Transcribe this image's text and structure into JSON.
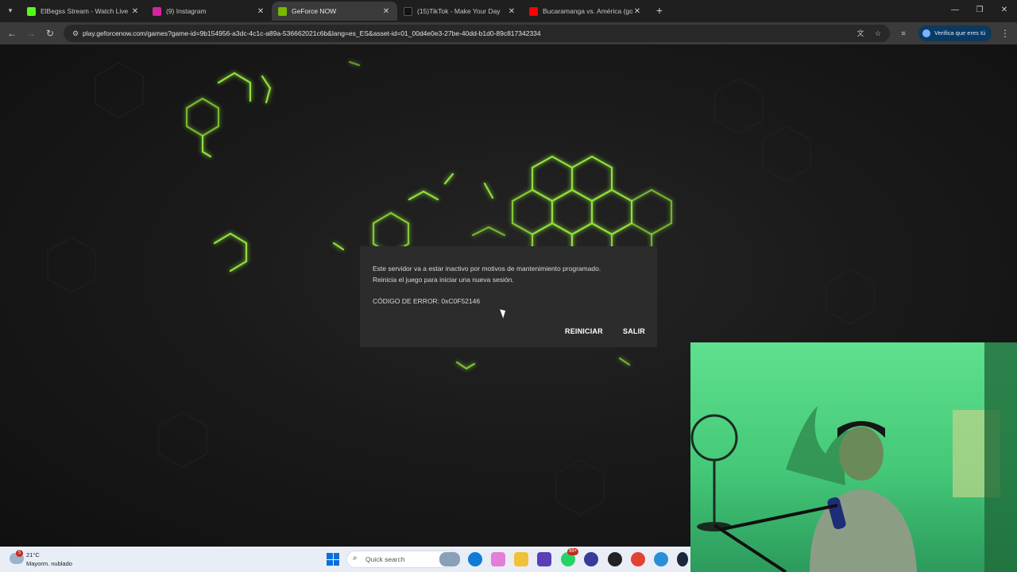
{
  "tabs": [
    {
      "title": "ElBegss Stream - Watch Live on",
      "favicon_color": "#53fc18",
      "favicon_icon": "kick-icon",
      "active": false
    },
    {
      "title": "(9) Instagram",
      "favicon_color": "#d6249f",
      "favicon_icon": "instagram-icon",
      "active": false
    },
    {
      "title": "GeForce NOW",
      "favicon_color": "#76b900",
      "favicon_icon": "nvidia-icon",
      "active": true
    },
    {
      "title": "(15)TikTok - Make Your Day",
      "favicon_color": "#111111",
      "favicon_icon": "tiktok-icon",
      "active": false
    },
    {
      "title": "Bucaramanga vs. América (gol",
      "favicon_color": "#ff0000",
      "favicon_icon": "youtube-icon",
      "active": false
    }
  ],
  "address_bar": {
    "url": "play.geforcenow.com/games?game-id=9b154956-a3dc-4c1c-a89a-536662021c6b&lang=es_ES&asset-id=01_00d4e0e3-27be-40dd-b1d0-89c817342334"
  },
  "profile_chip": {
    "label": "Verifica que eres tú"
  },
  "dialog": {
    "message_line1": "Este servidor va a estar inactivo por motivos de mantenimiento programado.",
    "message_line2": "Reinicia el juego para iniciar una nueva sesión.",
    "error_code": "CÓDIGO DE ERROR: 0xC0F52146",
    "restart_label": "REINICIAR",
    "exit_label": "SALIR"
  },
  "taskbar": {
    "weather_temp": "21°C",
    "weather_condition": "Mayorm. nublado",
    "weather_badge": "5",
    "search_placeholder": "Quick search",
    "app_badge": "99+"
  },
  "colors": {
    "geforce_green": "#76b900",
    "hex_glow": "#8fe03a",
    "dialog_bg": "#2c2c2c",
    "page_bg": "#1a1a1a"
  }
}
